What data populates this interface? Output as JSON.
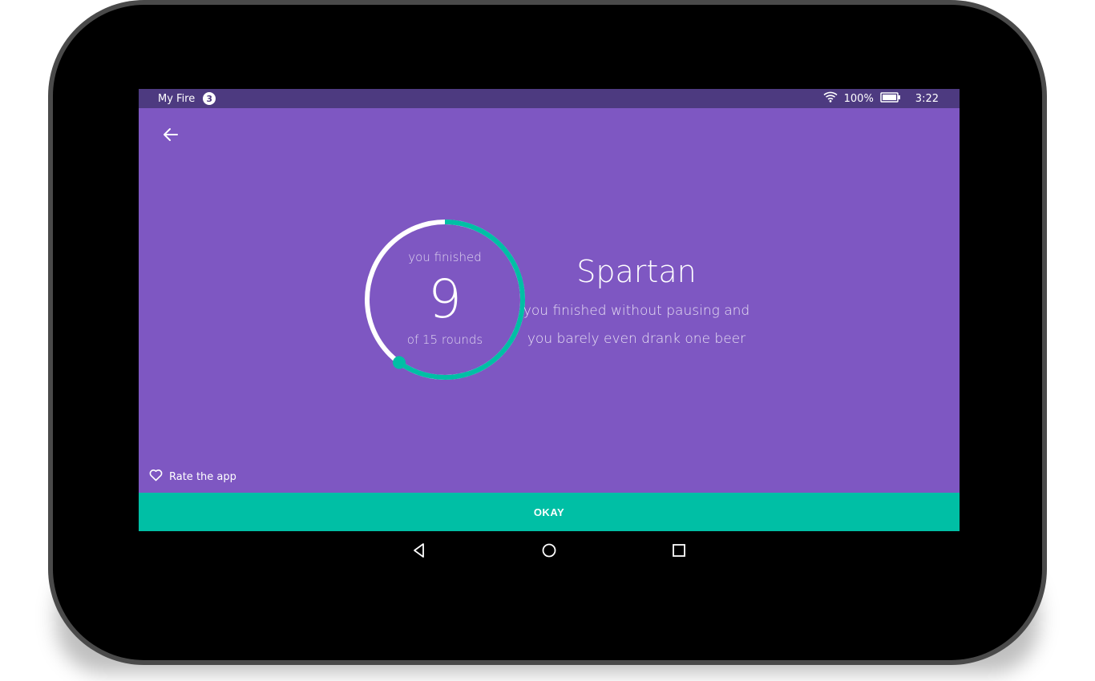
{
  "status_bar": {
    "app_name": "My Fire",
    "notification_count": "3",
    "battery": "100%",
    "time": "3:22",
    "icons": [
      "wifi-icon",
      "battery-icon"
    ]
  },
  "toolbar": {
    "back_icon": "arrow-left-icon"
  },
  "progress": {
    "top_label": "you finished",
    "rounds_done": "9",
    "bottom_label": "of 15 rounds",
    "fraction": 0.6
  },
  "result": {
    "title": "Spartan",
    "line1": "you finished without pausing and",
    "line2": "you barely even drank one beer"
  },
  "rate_app": {
    "label": "Rate the app",
    "icon": "heart-outline-icon"
  },
  "okay_button": {
    "label": "OKAY"
  },
  "nav_bar": {
    "icons": [
      "back-triangle-icon",
      "home-circle-icon",
      "recents-square-icon"
    ]
  },
  "colors": {
    "background": "#7e57c2",
    "status_bar": "#4d3a80",
    "accent": "#00bfa5",
    "ring_track": "#ffffff"
  }
}
